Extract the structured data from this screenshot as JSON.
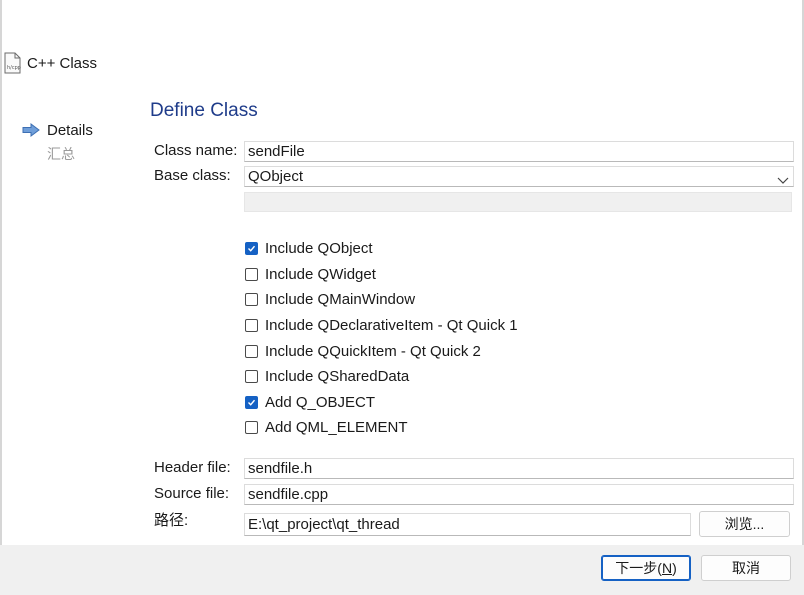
{
  "window": {
    "title": "C++ Class"
  },
  "nav": {
    "items": [
      {
        "label": "Details",
        "active": true
      },
      {
        "label": "汇总",
        "active": false
      }
    ]
  },
  "page": {
    "heading": "Define Class"
  },
  "form": {
    "class_name_label": "Class name:",
    "class_name_value": "sendFile",
    "base_class_label": "Base class:",
    "base_class_value": "QObject",
    "header_file_label": "Header file:",
    "header_file_value": "sendfile.h",
    "source_file_label": "Source file:",
    "source_file_value": "sendfile.cpp",
    "path_label": "路径:",
    "path_value": "E:\\qt_project\\qt_thread",
    "browse_label": "浏览..."
  },
  "checkboxes": [
    {
      "label": "Include QObject",
      "checked": true
    },
    {
      "label": "Include QWidget",
      "checked": false
    },
    {
      "label": "Include QMainWindow",
      "checked": false
    },
    {
      "label": "Include QDeclarativeItem - Qt Quick 1",
      "checked": false
    },
    {
      "label": "Include QQuickItem - Qt Quick 2",
      "checked": false
    },
    {
      "label": "Include QSharedData",
      "checked": false
    },
    {
      "label": "Add Q_OBJECT",
      "checked": true
    },
    {
      "label": "Add QML_ELEMENT",
      "checked": false
    }
  ],
  "buttons": {
    "next_prefix": "下一步(",
    "next_mnemonic": "N",
    "next_suffix": ")",
    "cancel": "取消"
  },
  "colors": {
    "accent": "#1561c4",
    "heading": "#1f3c8a"
  }
}
